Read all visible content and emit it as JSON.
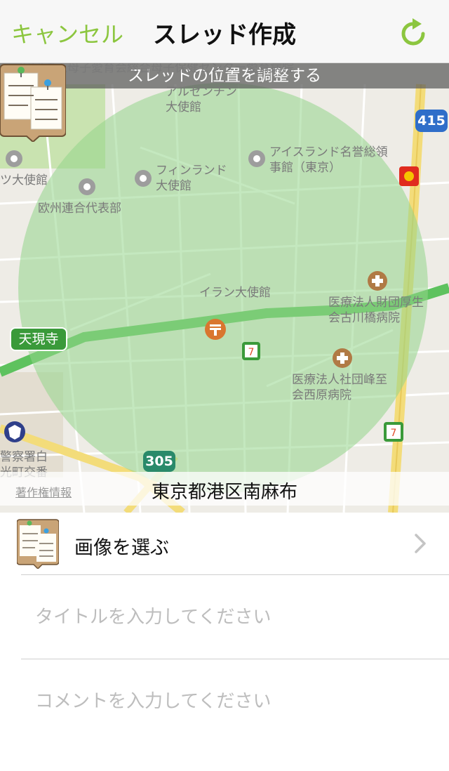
{
  "navbar": {
    "cancel_label": "キャンセル",
    "title": "スレッド作成",
    "refresh_icon": "refresh-icon",
    "accent_color": "#8cc63f"
  },
  "map": {
    "banner": "スレッドの位置を調整する",
    "address": "東京都港区南麻布",
    "copyright": "著作権情報",
    "route_415": "415",
    "route_305": "305",
    "station": "天現寺",
    "places": {
      "p1": "財団法人母子愛育会総合母子保健センター愛育病院",
      "p2": "アルゼンチン大使館",
      "p3": "アイスランド名誉総領事館（東京）",
      "p4": "ツ大使館",
      "p5": "フィンランド大使館",
      "p6": "欧州連合代表部",
      "p7": "イラン大使館",
      "p8": "医療法人財団厚生会古川橋病院",
      "p9": "医療法人社団峰至会西原病院",
      "p10": "警察署白光町交番"
    },
    "circle_color": "#93d68a"
  },
  "form": {
    "image_row_label": "画像を選ぶ",
    "title_placeholder": "タイトルを入力してください",
    "comment_placeholder": "コメントを入力してください"
  }
}
